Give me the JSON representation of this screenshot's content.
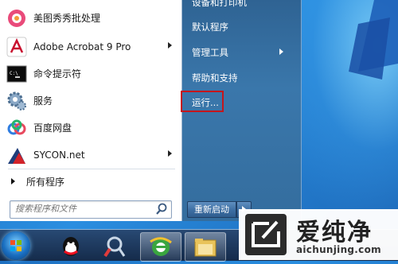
{
  "start_menu": {
    "programs": [
      {
        "label": "美图秀秀批处理",
        "icon": "meitu-icon",
        "has_submenu": false
      },
      {
        "label": "Adobe Acrobat 9 Pro",
        "icon": "acrobat-icon",
        "has_submenu": true
      },
      {
        "label": "命令提示符",
        "icon": "cmd-icon",
        "has_submenu": false
      },
      {
        "label": "服务",
        "icon": "services-gear-icon",
        "has_submenu": false
      },
      {
        "label": "百度网盘",
        "icon": "baidu-netdisk-icon",
        "has_submenu": false
      },
      {
        "label": "SYCON.net",
        "icon": "sycon-icon",
        "has_submenu": true
      }
    ],
    "all_programs_label": "所有程序",
    "search": {
      "placeholder": "搜索程序和文件"
    },
    "right_items": [
      {
        "label": "设备和打印机",
        "has_submenu": false
      },
      {
        "label": "默认程序",
        "has_submenu": false
      },
      {
        "label": "管理工具",
        "has_submenu": true
      },
      {
        "label": "帮助和支持",
        "has_submenu": false
      },
      {
        "label": "运行...",
        "has_submenu": false,
        "highlighted": true
      }
    ],
    "shutdown_label": "重新启动",
    "highlight_color": "#c4161c"
  },
  "taskbar": {
    "items": [
      "start-orb",
      "qq-icon",
      "tools-icon",
      "ie-icon",
      "file-explorer-icon"
    ]
  },
  "watermark": {
    "brand": "爱纯净",
    "url": "aichunjing.com"
  }
}
